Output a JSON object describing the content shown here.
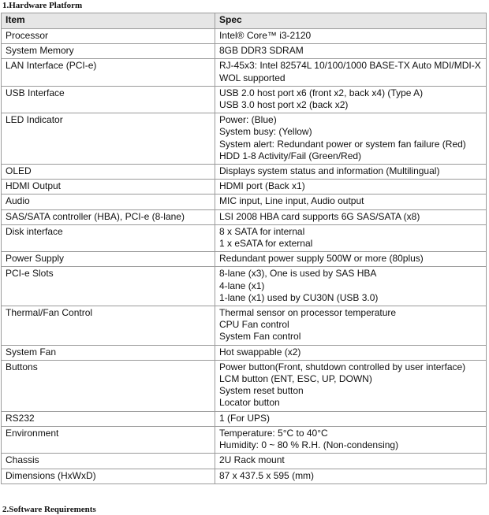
{
  "section_title": "1.Hardware Platform",
  "table": {
    "headers": [
      "Item",
      "Spec"
    ],
    "rows": [
      {
        "item": "Processor",
        "spec": [
          "Intel® Core™ i3-2120"
        ]
      },
      {
        "item": "System Memory",
        "spec": [
          "8GB DDR3 SDRAM"
        ]
      },
      {
        "item": "LAN Interface (PCI-e)",
        "spec": [
          "RJ-45x3: Intel 82574L 10/100/1000 BASE-TX Auto MDI/MDI-X",
          "WOL supported"
        ]
      },
      {
        "item": "USB Interface",
        "spec": [
          "USB 2.0 host port x6 (front x2, back x4) (Type A)",
          "USB 3.0 host port x2 (back x2)"
        ]
      },
      {
        "item": "LED Indicator",
        "spec": [
          "Power: (Blue)",
          "System busy: (Yellow)",
          "System alert: Redundant power or system fan failure (Red)",
          "HDD 1-8 Activity/Fail (Green/Red)"
        ]
      },
      {
        "item": "OLED",
        "spec": [
          "Displays system status and information (Multilingual)"
        ]
      },
      {
        "item": "HDMI Output",
        "spec": [
          "HDMI port (Back x1)"
        ]
      },
      {
        "item": "Audio",
        "spec": [
          "MIC input, Line input, Audio output"
        ]
      },
      {
        "item": "SAS/SATA controller (HBA), PCI-e (8-lane)",
        "spec": [
          "LSI 2008 HBA card supports 6G SAS/SATA (x8)"
        ]
      },
      {
        "item": "Disk interface",
        "spec": [
          "8 x SATA for internal",
          "1 x eSATA for external"
        ]
      },
      {
        "item": "Power Supply",
        "spec": [
          "Redundant power supply 500W or more (80plus)"
        ]
      },
      {
        "item": "PCI-e Slots",
        "spec": [
          "8-lane (x3), One is used by SAS HBA",
          "4-lane (x1)",
          "1-lane (x1) used by CU30N (USB 3.0)"
        ]
      },
      {
        "item": "Thermal/Fan Control",
        "spec": [
          "Thermal sensor on processor temperature",
          "CPU Fan control",
          "System Fan control"
        ]
      },
      {
        "item": "System Fan",
        "spec": [
          "Hot swappable (x2)"
        ]
      },
      {
        "item": "Buttons",
        "spec": [
          "Power button(Front, shutdown controlled by user interface)",
          "LCM button (ENT, ESC, UP, DOWN)",
          "System reset button",
          "Locator button"
        ]
      },
      {
        "item": "RS232",
        "spec": [
          "1 (For UPS)"
        ]
      },
      {
        "item": "Environment",
        "spec": [
          "Temperature: 5°C to 40°C",
          "Humidity: 0 ~ 80 % R.H. (Non-condensing)"
        ]
      },
      {
        "item": "Chassis",
        "spec": [
          "2U Rack mount"
        ]
      },
      {
        "item": "Dimensions (HxWxD)",
        "spec": [
          "87 x 437.5 x 595 (mm)"
        ]
      }
    ]
  },
  "colors": {
    "header_bg": "#e6e6e6",
    "border": "#9a9a9a",
    "text": "#111111"
  }
}
